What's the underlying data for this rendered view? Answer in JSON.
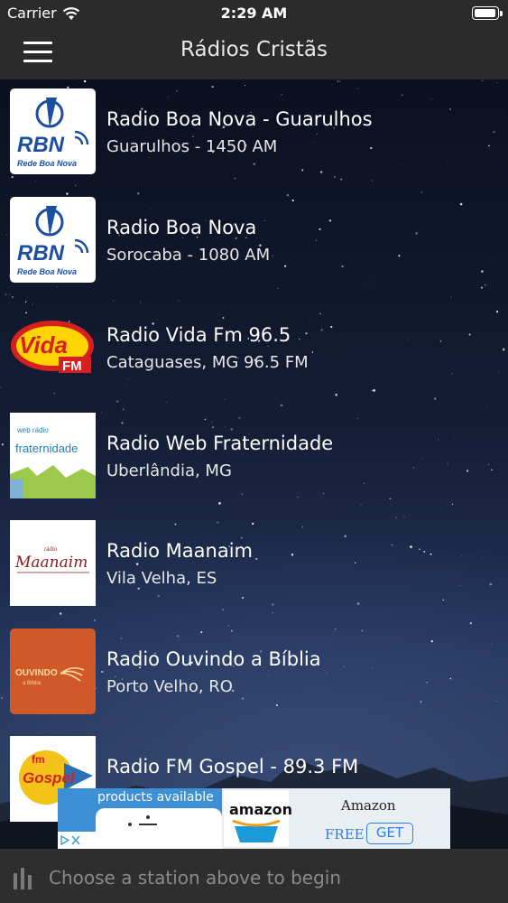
{
  "status": {
    "carrier": "Carrier",
    "time": "2:29 AM"
  },
  "nav": {
    "title": "Rádios Cristãs"
  },
  "stations": [
    {
      "title": "Radio Boa Nova - Guarulhos",
      "subtitle": "Guarulhos - 1450 AM",
      "logo_text": "RBN",
      "logo_caption": "Rede Boa Nova"
    },
    {
      "title": "Radio Boa Nova",
      "subtitle": "Sorocaba - 1080 AM",
      "logo_text": "RBN",
      "logo_caption": "Rede Boa Nova"
    },
    {
      "title": "Radio Vida Fm 96.5",
      "subtitle": "Cataguases, MG 96.5 FM",
      "logo_text": "Vida",
      "logo_caption": "FM"
    },
    {
      "title": "Radio Web Fraternidade",
      "subtitle": "Uberlândia, MG",
      "logo_text": "fraternidade",
      "logo_caption": "web rádio"
    },
    {
      "title": "Radio Maanaim",
      "subtitle": "Vila Velha, ES",
      "logo_text": "Maanaim",
      "logo_caption": "rádio"
    },
    {
      "title": "Radio Ouvindo a Bíblia",
      "subtitle": "Porto Velho, RO",
      "logo_text": "OUVINDO",
      "logo_caption": "a Bíblia"
    },
    {
      "title": "Radio FM Gospel - 89.3 FM",
      "subtitle": "",
      "logo_text": "Gospel",
      "logo_caption": "fm"
    }
  ],
  "ad": {
    "products": "products available",
    "store": "amazon",
    "brand": "Amazon",
    "price": "FREE",
    "cta": "GET"
  },
  "player": {
    "prompt": "Choose a station above to begin"
  },
  "colors": {
    "bar": "#2b2b2b",
    "rbn_blue": "#1d4fa0",
    "vida_red": "#d6201f",
    "ouvindo_orange": "#d0592a"
  }
}
